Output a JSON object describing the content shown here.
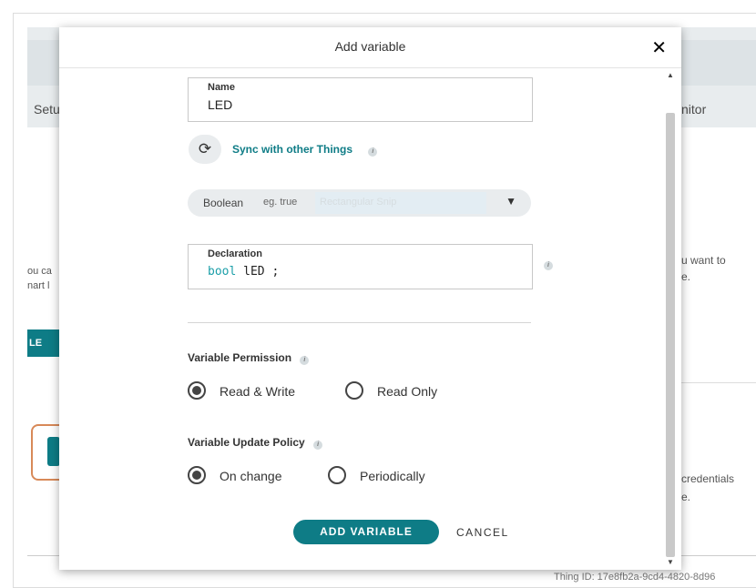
{
  "background": {
    "setup_tab": "Setu",
    "monitor_tab": "nitor",
    "left_text_1": "ou ca",
    "left_text_2": "nart l",
    "left_button": "LE",
    "right_text_1": "u want to",
    "right_text_2": "e.",
    "right_text_3": "credentials",
    "right_text_4": "e.",
    "thing_id": "Thing ID: 17e8fb2a-9cd4-4820-8d96"
  },
  "modal": {
    "title": "Add variable",
    "close_label": "✕",
    "name_field": {
      "label": "Name",
      "value": "LED"
    },
    "sync": {
      "label": "Sync with other Things",
      "icon": "sync-icon"
    },
    "type_select": {
      "type": "Boolean",
      "example": "eg. true",
      "snip_text": "Rectangular Snip"
    },
    "declaration": {
      "label": "Declaration",
      "keyword": "bool",
      "identifier": "lED",
      "terminator": ";"
    },
    "permission": {
      "label": "Variable Permission",
      "options": [
        "Read & Write",
        "Read Only"
      ],
      "selected": "Read & Write"
    },
    "update_policy": {
      "label": "Variable Update Policy",
      "options": [
        "On change",
        "Periodically"
      ],
      "selected": "On change"
    },
    "add_button": "ADD VARIABLE",
    "cancel_button": "CANCEL",
    "info_glyph": "i"
  },
  "colors": {
    "accent": "#0e7c86",
    "keyword": "#1a9ea8"
  }
}
